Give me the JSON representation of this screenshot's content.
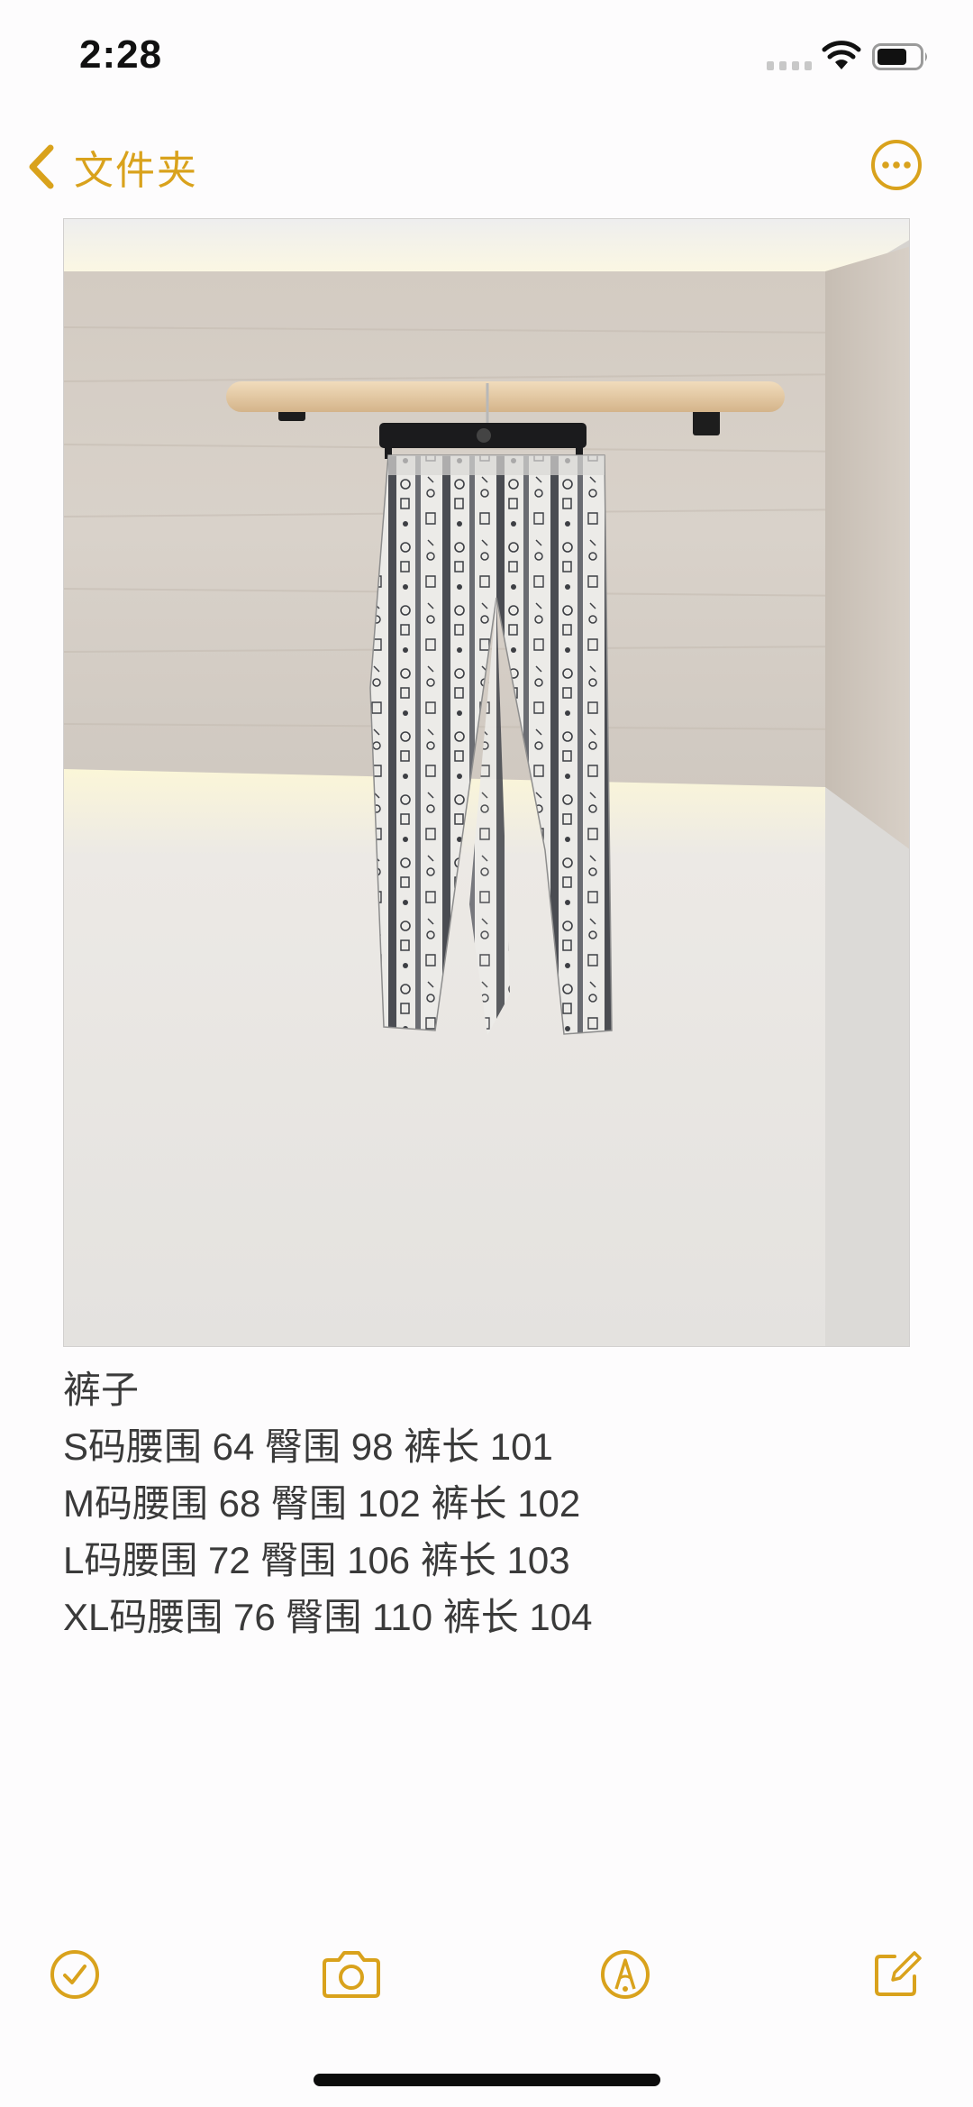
{
  "status_bar": {
    "time": "2:28"
  },
  "nav": {
    "back_label": "文件夹",
    "back_icon": "chevron-left-icon",
    "more_icon": "more-circle-icon"
  },
  "photo": {
    "subject": "pants-on-hanger-photo"
  },
  "note": {
    "lines": [
      "裤子",
      "S码腰围 64 臀围 98 裤长 101",
      "M码腰围 68 臀围 102 裤长 102",
      "L码腰围 72 臀围 106 裤长 103",
      "XL码腰围 76 臀围 110 裤长 104"
    ]
  },
  "toolbar": {
    "items": [
      "checklist-icon",
      "camera-icon",
      "markup-icon",
      "compose-icon"
    ]
  },
  "colors": {
    "accent": "#d9a21c",
    "text": "#3a3a3a",
    "background": "#fdfcfd"
  }
}
